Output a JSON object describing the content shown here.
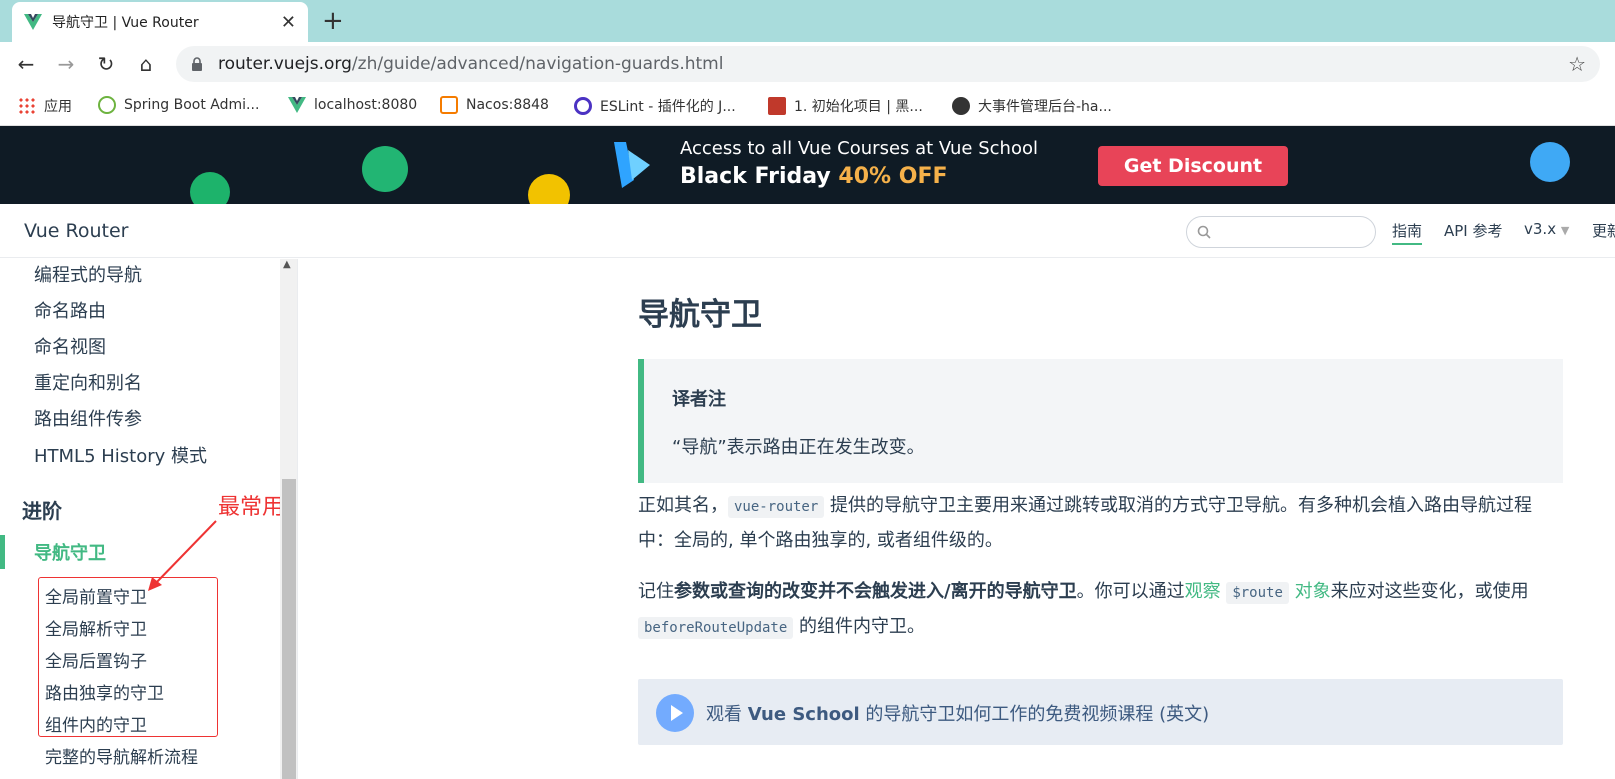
{
  "browser": {
    "tab_title": "导航守卫 | Vue Router",
    "url_host": "router.vuejs.org",
    "url_path": "/zh/guide/advanced/navigation-guards.html"
  },
  "bookmarks": [
    {
      "label": "应用",
      "icon": "apps-grid-icon"
    },
    {
      "label": "Spring Boot Admi...",
      "icon": "spring-icon"
    },
    {
      "label": "localhost:8080",
      "icon": "vue-icon"
    },
    {
      "label": "Nacos:8848",
      "icon": "nacos-icon"
    },
    {
      "label": "ESLint - 插件化的 J...",
      "icon": "eslint-icon"
    },
    {
      "label": "1. 初始化项目 | 黑...",
      "icon": "heima-icon"
    },
    {
      "label": "大事件管理后台-ha...",
      "icon": "globe-icon"
    }
  ],
  "banner": {
    "line1": "Access to all Vue Courses at Vue School",
    "line2_prefix": "Black Friday ",
    "line2_highlight": "40% OFF",
    "cta": "Get Discount"
  },
  "header": {
    "brand": "Vue Router",
    "nav_guide": "指南",
    "nav_api": "API 参考",
    "nav_version": "v3.x",
    "nav_more": "更新"
  },
  "sidebar": {
    "items": [
      "编程式的导航",
      "命名路由",
      "命名视图",
      "重定向和别名",
      "路由组件传参",
      "HTML5 History 模式"
    ],
    "group": "进阶",
    "active": "导航守卫",
    "subitems": [
      "全局前置守卫",
      "全局解析守卫",
      "全局后置钩子",
      "路由独享的守卫",
      "组件内的守卫",
      "完整的导航解析流程"
    ],
    "annotation": "最常用"
  },
  "content": {
    "title": "导航守卫",
    "tip_title": "译者注",
    "tip_body": "“导航”表示路由正在发生改变。",
    "p1_a": "正如其名，",
    "p1_code": "vue-router",
    "p1_b": " 提供的导航守卫主要用来通过跳转或取消的方式守卫导航。有多种机会植入路由导航过程中：全局的, 单个路由独享的, 或者组件级的。",
    "p2_a": "记住",
    "p2_bold": "参数或查询的改变并不会触发进入/离开的导航守卫",
    "p2_b": "。你可以通过",
    "p2_link1": "观察",
    "p2_code1": "$route",
    "p2_link2": "对象",
    "p2_c": "来应对这些变化，或使用",
    "p2_code2": "beforeRouteUpdate",
    "p2_d": " 的组件内守卫。",
    "vs_a": "观看 ",
    "vs_bold": "Vue School",
    "vs_b": " 的导航守卫如何工作的免费视频课程 (英文)"
  }
}
